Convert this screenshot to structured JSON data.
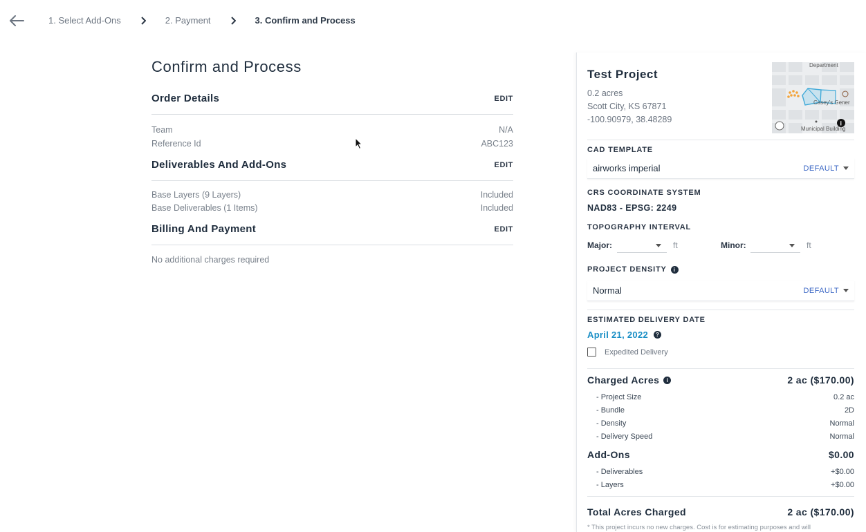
{
  "breadcrumb": {
    "steps": [
      "1. Select Add-Ons",
      "2. Payment",
      "3. Confirm and Process"
    ]
  },
  "main": {
    "title": "Confirm and Process",
    "order_details": {
      "title": "Order Details",
      "edit_label": "EDIT",
      "rows": [
        {
          "label": "Team",
          "value": "N/A"
        },
        {
          "label": "Reference Id",
          "value": "ABC123"
        }
      ]
    },
    "deliverables": {
      "title": "Deliverables And Add-Ons",
      "edit_label": "EDIT",
      "rows": [
        {
          "label": "Base Layers (9 Layers)",
          "value": "Included"
        },
        {
          "label": "Base Deliverables (1 Items)",
          "value": "Included"
        }
      ]
    },
    "billing": {
      "title": "Billing And Payment",
      "edit_label": "EDIT",
      "note": "No additional charges required"
    }
  },
  "panel": {
    "project_title": "Test Project",
    "area": "0.2 acres",
    "location": "Scott City, KS 67871",
    "coords": "-100.90979, 38.48289",
    "map_labels": {
      "top": "Department",
      "right": "Casey's Gener",
      "bottom": "Municipal Building"
    },
    "cad_template": {
      "label": "CAD TEMPLATE",
      "value": "airworks imperial",
      "tag": "DEFAULT"
    },
    "crs": {
      "label": "CRS COORDINATE SYSTEM",
      "value": "NAD83 - EPSG: 2249"
    },
    "topography": {
      "label": "TOPOGRAPHY INTERVAL",
      "major_label": "Major:",
      "minor_label": "Minor:",
      "unit": "ft"
    },
    "density": {
      "label": "PROJECT DENSITY",
      "value": "Normal",
      "tag": "DEFAULT"
    },
    "delivery": {
      "label": "ESTIMATED DELIVERY DATE",
      "date": "April 21, 2022",
      "expedited_label": "Expedited Delivery",
      "expedited_checked": false
    },
    "charged_acres": {
      "title": "Charged Acres",
      "total": "2 ac ($170.00)",
      "lines": [
        {
          "label": "- Project Size",
          "value": "0.2 ac"
        },
        {
          "label": "- Bundle",
          "value": "2D"
        },
        {
          "label": "- Density",
          "value": "Normal"
        },
        {
          "label": "- Delivery Speed",
          "value": "Normal"
        }
      ]
    },
    "addons": {
      "title": "Add-Ons",
      "total": "$0.00",
      "lines": [
        {
          "label": "- Deliverables",
          "value": "+$0.00"
        },
        {
          "label": "- Layers",
          "value": "+$0.00"
        }
      ]
    },
    "total": {
      "title": "Total Acres Charged",
      "value": "2 ac ($170.00)"
    },
    "footnote": "* This project incurs no new charges. Cost is for estimating purposes and will"
  },
  "colors": {
    "accent": "#1b8fc6",
    "default_tag": "#3a66c4",
    "text": "#1f2d3d",
    "muted": "#6b7480"
  }
}
